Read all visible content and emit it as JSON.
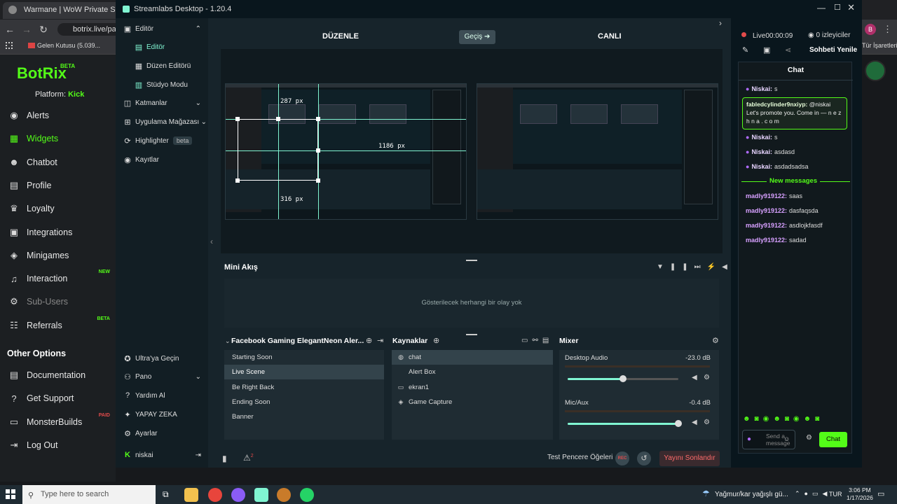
{
  "browser": {
    "tab_title": "Warmane | WoW Private Server",
    "url": "botrix.live/pan",
    "bookmark": "Gelen Kutusu (5.039...",
    "bookmark_right": "Tür İşaretleri",
    "profile_initial": "B"
  },
  "botrix": {
    "logo": "BotRix",
    "beta": "BETA",
    "platform_label": "Platform:",
    "platform_value": "Kick",
    "items": [
      {
        "label": "Alerts",
        "icon": "alerts-icon",
        "glyph": "◉",
        "badge": ""
      },
      {
        "label": "Widgets",
        "icon": "widgets-icon",
        "glyph": "▦",
        "badge": ""
      },
      {
        "label": "Chatbot",
        "icon": "chatbot-icon",
        "glyph": "☻",
        "badge": ""
      },
      {
        "label": "Profile",
        "icon": "profile-icon",
        "glyph": "▤",
        "badge": ""
      },
      {
        "label": "Loyalty",
        "icon": "trophy-icon",
        "glyph": "♛",
        "badge": ""
      },
      {
        "label": "Integrations",
        "icon": "integrations-icon",
        "glyph": "▣",
        "badge": ""
      },
      {
        "label": "Minigames",
        "icon": "gamepad-icon",
        "glyph": "◈",
        "badge": ""
      },
      {
        "label": "Interaction",
        "icon": "music-icon",
        "glyph": "♫",
        "badge": "NEW"
      },
      {
        "label": "Sub-Users",
        "icon": "sub-users-icon",
        "glyph": "⚙",
        "badge": ""
      },
      {
        "label": "Referrals",
        "icon": "referrals-icon",
        "glyph": "☷",
        "badge": "BETA"
      }
    ],
    "other_options": "Other Options",
    "other_items": [
      {
        "label": "Documentation",
        "icon": "documentation-icon",
        "glyph": "▤",
        "badge": ""
      },
      {
        "label": "Get Support",
        "icon": "support-icon",
        "glyph": "?",
        "badge": ""
      },
      {
        "label": "MonsterBuilds",
        "icon": "monitor-icon",
        "glyph": "▭",
        "badge": "PAID"
      },
      {
        "label": "Log Out",
        "icon": "logout-icon",
        "glyph": "⇥",
        "badge": ""
      }
    ]
  },
  "streamlabs": {
    "title": "Streamlabs Desktop - 1.20.4",
    "nav": {
      "editor_group": "Editör",
      "editor": "Editör",
      "layout_editor": "Düzen Editörü",
      "studio_mode": "Stüdyo Modu",
      "layers": "Katmanlar",
      "app_store": "Uygulama Mağazası",
      "highlighter": "Highlighter",
      "highlighter_badge": "beta",
      "recordings": "Kayıtlar",
      "ultra": "Ultra'ya Geçin",
      "dashboard": "Pano",
      "help": "Yardım Al",
      "ai": "YAPAY ZEKA",
      "settings": "Ayarlar",
      "user": "niskai"
    },
    "studio": {
      "edit_label": "DÜZENLE",
      "transition_button": "Geçiş ➔",
      "live_label": "CANLI",
      "measure_top": "287 px",
      "measure_right": "1186 px",
      "measure_bottom": "316 px"
    },
    "mini_feed": {
      "title": "Mini Akış",
      "empty": "Gösterilecek herhangi bir olay yok"
    },
    "scenes": {
      "title": "Facebook Gaming ElegantNeon Aler...",
      "items": [
        "Starting Soon",
        "Live Scene",
        "Be Right Back",
        "Ending Soon",
        "Banner"
      ],
      "selected": 1
    },
    "sources": {
      "title": "Kaynaklar",
      "items": [
        {
          "label": "chat",
          "icon": "globe-icon",
          "glyph": "◍"
        },
        {
          "label": "Alert Box",
          "icon": "alert-box-icon",
          "glyph": ""
        },
        {
          "label": "ekran1",
          "icon": "display-icon",
          "glyph": "▭"
        },
        {
          "label": "Game Capture",
          "icon": "gamepad-icon",
          "glyph": "◈"
        }
      ],
      "selected": 0
    },
    "mixer": {
      "title": "Mixer",
      "channels": [
        {
          "name": "Desktop Audio",
          "db": "-23.0 dB",
          "level": 0.5
        },
        {
          "name": "Mic/Aux",
          "db": "-0.4 dB",
          "level": 1.0
        }
      ]
    },
    "footer": {
      "test_widgets": "Test Pencere Öğeleri",
      "rec": "REC",
      "end_stream": "Yayını Sonlandır",
      "alert_count": "2"
    },
    "chat": {
      "live_label": "Live",
      "live_time": "00:00:09",
      "viewers": "0 izleyiciler",
      "refresh": "Sohbeti Yenile",
      "title": "Chat",
      "new_messages": "New messages",
      "messages_top": [
        {
          "name": "Niskai:",
          "text": "s"
        }
      ],
      "highlight": {
        "name": "fabledcylinder9nxiyp:",
        "text": "@niskai Let's promote you. Come in — n e z h n a . c o m"
      },
      "messages_mid": [
        {
          "name": "Niskai:",
          "text": "s"
        },
        {
          "name": "Niskai:",
          "text": "asdasd"
        },
        {
          "name": "Niskai:",
          "text": "asdadsadsa"
        }
      ],
      "messages_new": [
        {
          "name": "madly919122:",
          "text": "saas"
        },
        {
          "name": "madly919122:",
          "text": "dasfaqsda"
        },
        {
          "name": "madly919122:",
          "text": "asdlojkfasdf"
        },
        {
          "name": "madly919122:",
          "text": "sadad"
        }
      ],
      "input_placeholder": "Send a message",
      "send_button": "Chat"
    }
  },
  "taskbar": {
    "search_placeholder": "Type here to search",
    "weather": "Yağmur/kar yağışlı gü...",
    "lang": "TUR",
    "time": "3:06 PM",
    "date": "1/17/2026"
  },
  "colors": {
    "kick_green": "#53fc18",
    "accent": "#80f5d2",
    "end_red": "#e24b4b"
  }
}
